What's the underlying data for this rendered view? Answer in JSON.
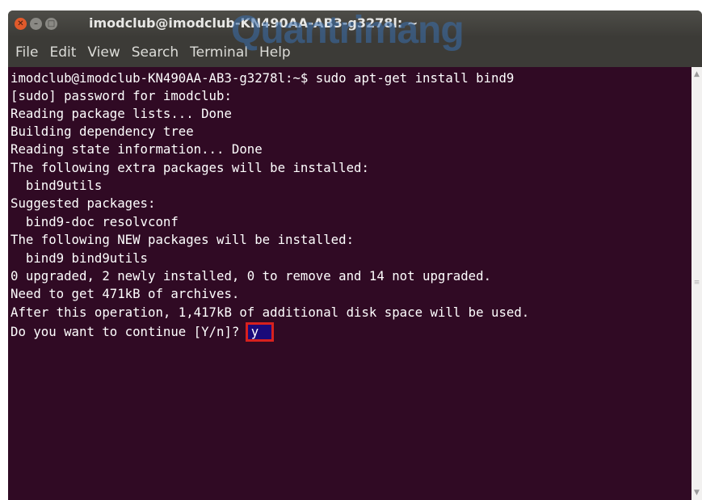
{
  "window": {
    "title": "imodclub@imodclub-KN490AA-AB3-g3278l: ~",
    "close_glyph": "✕",
    "minimize_glyph": "–",
    "maximize_glyph": "□"
  },
  "watermark": "Quantrimang",
  "menu": [
    "File",
    "Edit",
    "View",
    "Search",
    "Terminal",
    "Help"
  ],
  "terminal": {
    "lines": [
      "imodclub@imodclub-KN490AA-AB3-g3278l:~$ sudo apt-get install bind9",
      "[sudo] password for imodclub:",
      "Reading package lists... Done",
      "Building dependency tree",
      "Reading state information... Done",
      "The following extra packages will be installed:",
      "  bind9utils",
      "Suggested packages:",
      "  bind9-doc resolvconf",
      "The following NEW packages will be installed:",
      "  bind9 bind9utils",
      "0 upgraded, 2 newly installed, 0 to remove and 14 not upgraded.",
      "Need to get 471kB of archives.",
      "After this operation, 1,417kB of additional disk space will be used."
    ],
    "prompt": "Do you want to continue [Y/n]? ",
    "input": "y"
  },
  "colors": {
    "terminal_bg": "#300a24",
    "highlight_border": "#d7211e",
    "close_button": "#e05a2b"
  }
}
